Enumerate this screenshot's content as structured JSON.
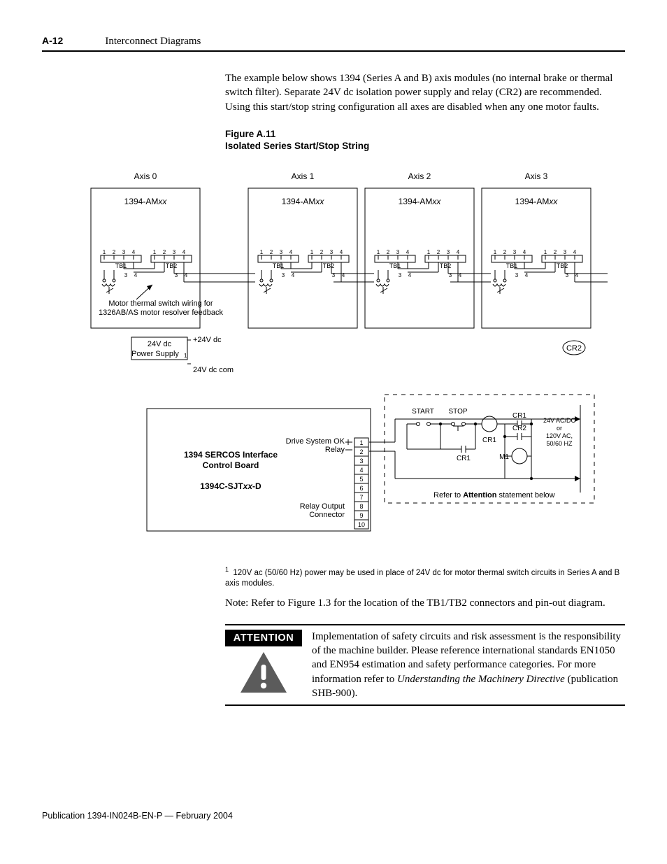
{
  "header": {
    "pageNum": "A-12",
    "section": "Interconnect Diagrams"
  },
  "intro": "The example below shows 1394 (Series A and B) axis modules (no internal brake or thermal switch filter). Separate 24V dc isolation power supply and relay (CR2) are recommended. Using this start/stop string configuration all axes are disabled when any one motor faults.",
  "figure": {
    "number": "Figure A.11",
    "title": "Isolated Series Start/Stop String",
    "axes": [
      "Axis 0",
      "Axis 1",
      "Axis 2",
      "Axis 3"
    ],
    "moduleLabel": "1394-AM",
    "moduleSuffix": "xx",
    "tb1": "TB1",
    "tb2": "TB2",
    "pins": [
      "1",
      "2",
      "3",
      "4"
    ],
    "pins34": [
      "3",
      "4"
    ],
    "thermalNote1": "Motor thermal switch wiring for",
    "thermalNote2": "1326AB/AS motor resolver feedback",
    "psLabel1": "24V dc",
    "psLabel2": "Power Supply",
    "psSup": "1",
    "psPlus": "+24V dc",
    "psCom": "24V dc com",
    "cr2": "CR2",
    "board": {
      "l1": "1394 SERCOS Interface",
      "l2": "Control Board",
      "l3": "1394C-SJT",
      "l3b": "xx",
      "l3c": "-D",
      "dsok1": "Drive System OK",
      "dsok2": "Relay",
      "relayOut1": "Relay Output",
      "relayOut2": "Connector",
      "connPins": [
        "1",
        "2",
        "3",
        "4",
        "5",
        "6",
        "7",
        "8",
        "9",
        "10"
      ]
    },
    "relayArea": {
      "start": "START",
      "stop": "STOP",
      "cr1": "CR1",
      "cr2": "CR2",
      "m1": "M1",
      "volt1": "24V AC/DC",
      "volt2": "or",
      "volt3": "120V AC,",
      "volt4": "50/60 HZ",
      "refer1": "Refer to ",
      "refer2": "Attention",
      "refer3": " statement below"
    }
  },
  "footnote": "120V ac (50/60 Hz) power may be used in place of 24V dc for motor thermal switch circuits in Series A and B axis modules.",
  "note": "Note: Refer to Figure 1.3 for the location of the TB1/TB2 connectors and pin-out diagram.",
  "attention": {
    "label": "ATTENTION",
    "text1": "Implementation of safety circuits and risk assessment is the responsibility of the machine builder. Please reference international standards EN1050 and EN954 estimation and safety performance categories. For more information refer to ",
    "textItalic": "Understanding the Machinery Directive",
    "text2": " (publication SHB-900)."
  },
  "publication": "Publication 1394-IN024B-EN-P — February 2004"
}
